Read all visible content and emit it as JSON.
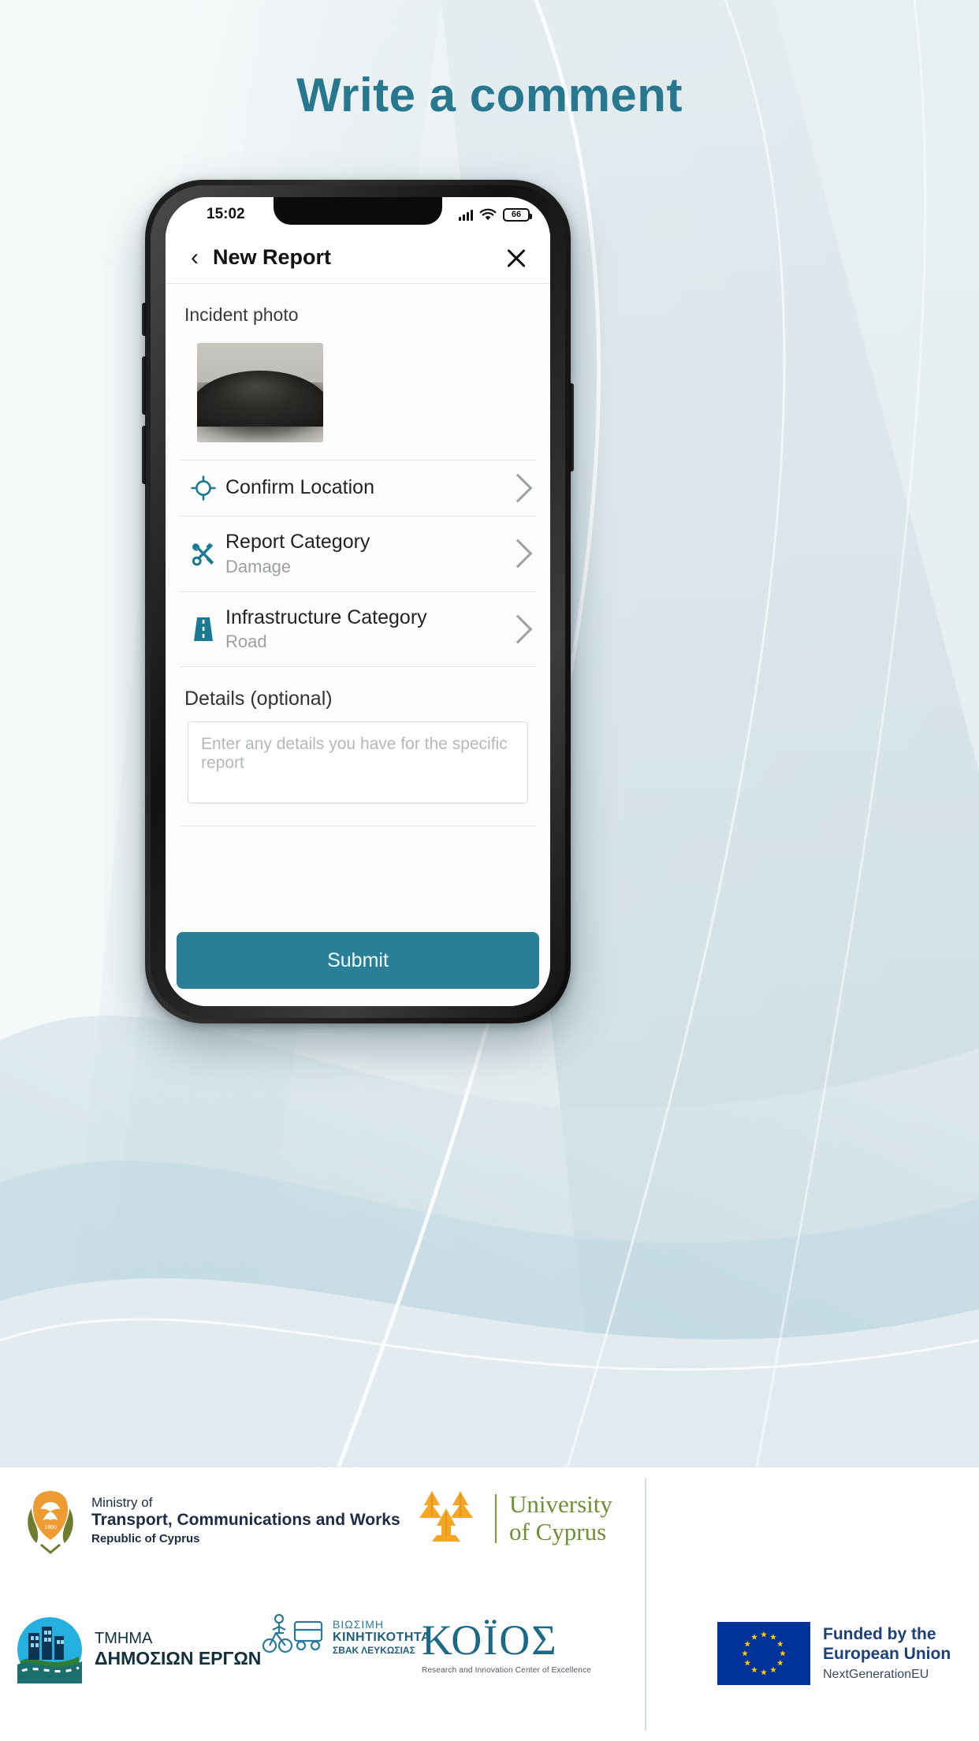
{
  "page": {
    "title": "Write a comment",
    "title_color": "#27788f",
    "background_color": "#eef3f5"
  },
  "phone": {
    "status_bar": {
      "time": "15:02",
      "signal_icon": "signal-bars-icon",
      "wifi_icon": "wifi-icon",
      "battery_icon": "battery-icon",
      "battery_level": "66"
    },
    "nav": {
      "back_icon": "chevron-left-icon",
      "title": "New Report",
      "close_icon": "close-icon"
    },
    "content": {
      "photo_label": "Incident photo",
      "photo_alt": "incident-photo-thumbnail",
      "rows": [
        {
          "icon": "crosshair-location-icon",
          "title": "Confirm Location",
          "subtitle": "",
          "chevron": "chevron-right-icon"
        },
        {
          "icon": "tools-wrench-screwdriver-icon",
          "title": "Report Category",
          "subtitle": "Damage",
          "chevron": "chevron-right-icon"
        },
        {
          "icon": "road-icon",
          "title": "Infrastructure Category",
          "subtitle": "Road",
          "chevron": "chevron-right-icon"
        }
      ],
      "details_label": "Details (optional)",
      "details_value": "",
      "details_placeholder": "Enter any details you have for the specific report",
      "submit_label": "Submit",
      "submit_color": "#2a7f96",
      "accent_color": "#1b7a93"
    }
  },
  "footer": {
    "ministry": {
      "emblem": "cyprus-coat-of-arms-icon",
      "line1": "Ministry of",
      "line2": "Transport, Communications and Works",
      "line3": "Republic of Cyprus"
    },
    "university": {
      "emblem": "ucy-tree-icon",
      "line1": "University",
      "line2": "of Cyprus"
    },
    "department": {
      "emblem": "public-works-department-icon",
      "line1": "ΤΜΗΜΑ",
      "line2": "ΔΗΜΟΣΙΩΝ ΕΡΓΩΝ"
    },
    "sbak": {
      "emblem": "sustainable-mobility-icon",
      "line1": "ΒΙΩΣΙΜΗ",
      "line2": "ΚΙΝΗΤΙΚΟΤΗΤΑ",
      "line3": "ΣΒΑΚ ΛΕΥΚΩΣΙΑΣ"
    },
    "koios": {
      "brand": "ΚΟΪΟΣ",
      "subtitle": "Research and Innovation Center of Excellence"
    },
    "eu": {
      "flag": "eu-flag-icon",
      "line1": "Funded by the",
      "line2": "European Union",
      "line3": "NextGenerationEU"
    }
  }
}
